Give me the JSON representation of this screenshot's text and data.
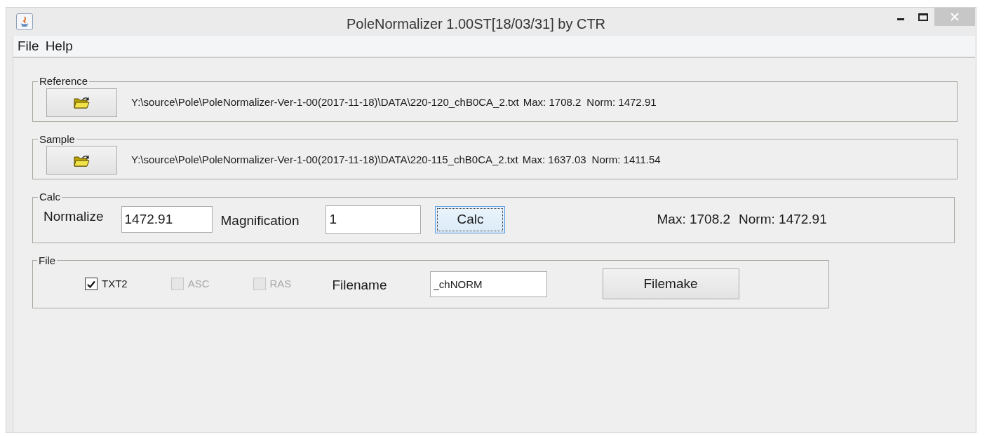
{
  "window": {
    "title": "PoleNormalizer 1.00ST[18/03/31] by CTR"
  },
  "menu": [
    "File",
    "Help"
  ],
  "reference": {
    "legend": "Reference",
    "path": "Y:\\source\\Pole\\PoleNormalizer-Ver-1-00(2017-11-18)\\DATA\\220-120_chB0CA_2.txt",
    "max": "Max: 1708.2",
    "norm": "Norm: 1472.91"
  },
  "sample": {
    "legend": "Sample",
    "path": "Y:\\source\\Pole\\PoleNormalizer-Ver-1-00(2017-11-18)\\DATA\\220-115_chB0CA_2.txt",
    "max": "Max: 1637.03",
    "norm": "Norm: 1411.54"
  },
  "calc": {
    "legend": "Calc",
    "normalize_label": "Normalize",
    "normalize_value": "1472.91",
    "magnification_label": "Magnification",
    "magnification_value": "1",
    "button": {
      "label": "Calc",
      "focused": true
    },
    "max": "Max: 1708.2",
    "norm": "Norm: 1472.91"
  },
  "file": {
    "legend": "File",
    "checkboxes": [
      {
        "label": "TXT2",
        "checked": true,
        "disabled": false
      },
      {
        "label": "ASC",
        "checked": false,
        "disabled": true
      },
      {
        "label": "RAS",
        "checked": false,
        "disabled": true
      }
    ],
    "filename_label": "Filename",
    "filename_value": "_chNORM",
    "button": "Filemake"
  }
}
